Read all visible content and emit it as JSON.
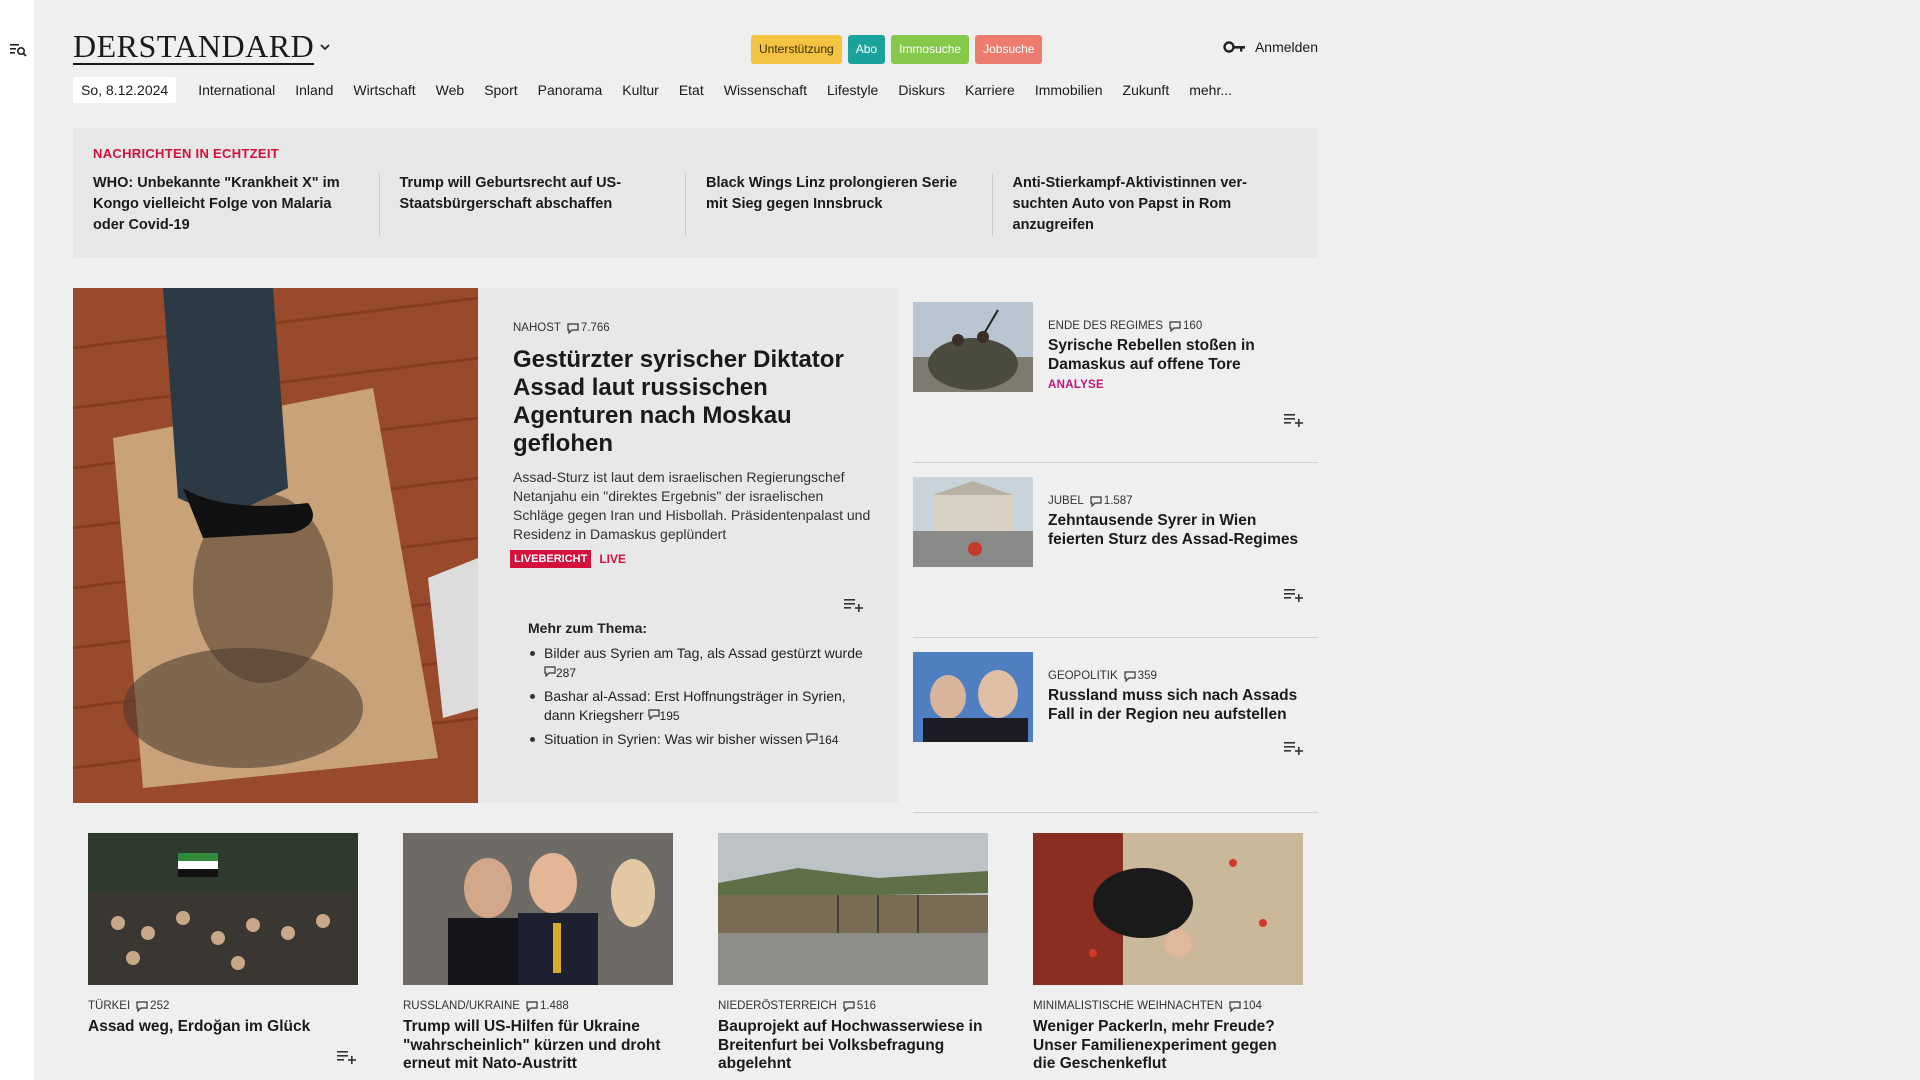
{
  "header": {
    "logo": "DERSTANDARD",
    "pills": [
      "Unterstützung",
      "Abo",
      "Immosuche",
      "Jobsuche"
    ],
    "login": "Anmelden"
  },
  "nav": {
    "date": "So, 8.12.2024",
    "items": [
      "International",
      "Inland",
      "Wirtschaft",
      "Web",
      "Sport",
      "Panorama",
      "Kultur",
      "Etat",
      "Wissenschaft",
      "Lifestyle",
      "Diskurs",
      "Karriere",
      "Immobilien",
      "Zukunft",
      "mehr..."
    ]
  },
  "ticker": {
    "heading": "NACHRICHTEN IN ECHTZEIT",
    "items": [
      "WHO: Unbekannte \"Krankheit X\" im Kongo vielleicht Folge von Malaria oder Covid-19",
      "Trump will Geburtsrecht auf US-Staatsbürgerschaft abschaffen",
      "Black Wings Linz prolongieren Serie mit Sieg gegen Innsbruck",
      "Anti-Stierkampf-Aktivistinnen ver-suchten Auto von Papst in Rom anzugreifen"
    ]
  },
  "lead": {
    "kicker": "NAHOST",
    "comments": "7.766",
    "title": "Gestürzter syrischer Diktator Assad laut russischen Agenturen nach Moskau geflohen",
    "teaser": "Assad-Sturz ist laut dem israelischen Regierungschef Netanjahu ein \"direktes Ergebnis\" der israelischen Schläge gegen Iran und Hisbollah. Präsidentenpalast und Residenz in Damaskus geplündert",
    "badge": "LIVEBERICHT",
    "live": "LIVE",
    "more_heading": "Mehr zum Thema:",
    "more": [
      {
        "text": "Bilder aus Syrien am Tag, als Assad gestürzt wurde",
        "comments": "287"
      },
      {
        "text": "Bashar al-Assad: Erst Hoffnungsträger in Syrien, dann Kriegsherr",
        "comments": "195"
      },
      {
        "text": "Situation in Syrien: Was wir bisher wissen",
        "comments": "164"
      }
    ]
  },
  "side": [
    {
      "kicker": "ENDE DES REGIMES",
      "comments": "160",
      "title": "Syrische Rebellen stoßen in Damaskus auf offene Tore",
      "tag": "ANALYSE"
    },
    {
      "kicker": "JUBEL",
      "comments": "1.587",
      "title": "Zehntausende Syrer in Wien feierten Sturz des Assad-Regimes",
      "tag": ""
    },
    {
      "kicker": "GEOPOLITIK",
      "comments": "359",
      "title": "Russland muss sich nach Assads Fall in der Region neu aufstellen",
      "tag": ""
    }
  ],
  "cards": [
    {
      "kicker": "TÜRKEI",
      "comments": "252",
      "title": "Assad weg, Erdoğan im Glück"
    },
    {
      "kicker": "RUSSLAND/UKRAINE",
      "comments": "1.488",
      "title": "Trump will US-Hilfen für Ukraine \"wahrscheinlich\" kürzen und droht erneut mit Nato-Austritt"
    },
    {
      "kicker": "NIEDERÖSTERREICH",
      "comments": "516",
      "title": "Bauprojekt auf Hochwasserwiese in Breitenfurt bei Volksbefragung abgelehnt"
    },
    {
      "kicker": "MINIMALISTISCHE WEIHNACHTEN",
      "comments": "104",
      "title": "Weniger Packerln, mehr Freude? Unser Familienexperiment gegen die Geschenkeflut"
    }
  ]
}
